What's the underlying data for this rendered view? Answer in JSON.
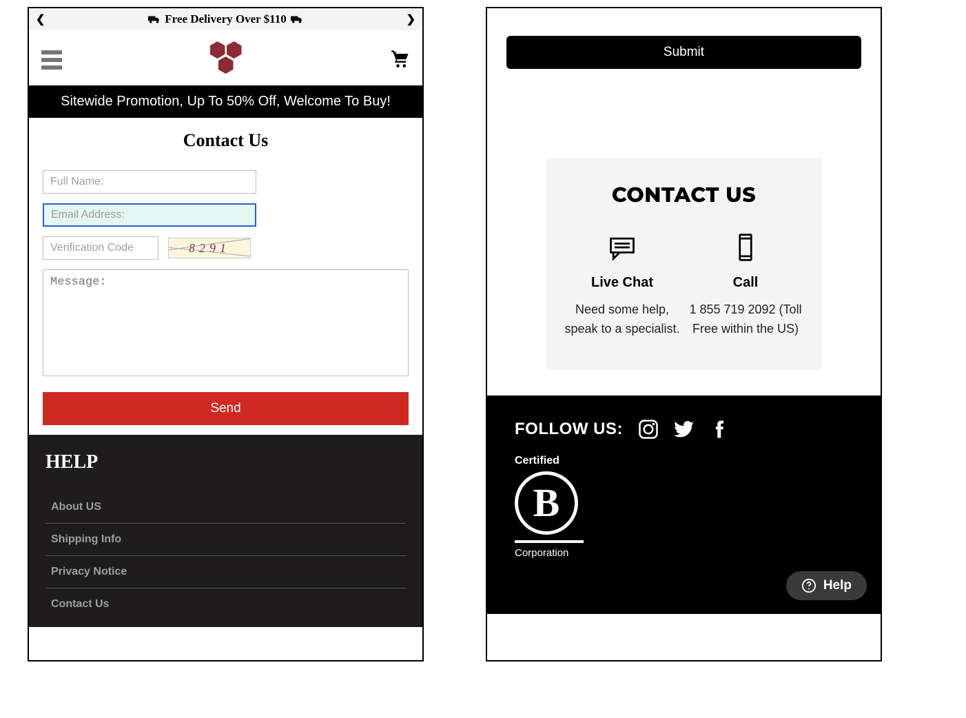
{
  "left": {
    "topbar": {
      "text": "Free Delivery Over $110"
    },
    "promo": "Sitewide Promotion, Up To 50% Off, Welcome To Buy!",
    "title": "Contact Us",
    "form": {
      "full_name_ph": "Full Name:",
      "email_ph": "Email Address:",
      "verif_ph": "Verification Code",
      "captcha": "8291",
      "msg_ph": "Message:",
      "send": "Send"
    },
    "footer": {
      "heading": "HELP",
      "links": [
        "About US",
        "Shipping Info",
        "Privacy Notice",
        "Contact Us"
      ]
    }
  },
  "right": {
    "submit": "Submit",
    "contact": {
      "heading": "CONTACT US",
      "chat": {
        "title": "Live Chat",
        "text": "Need some help, speak to a specialist."
      },
      "call": {
        "title": "Call",
        "text": "1 855 719 2092 (Toll Free within the US)"
      }
    },
    "footer": {
      "follow": "FOLLOW US:",
      "bcorp_top": "Certified",
      "bcorp_letter": "B",
      "bcorp_bottom": "Corporation",
      "help": "Help"
    }
  }
}
